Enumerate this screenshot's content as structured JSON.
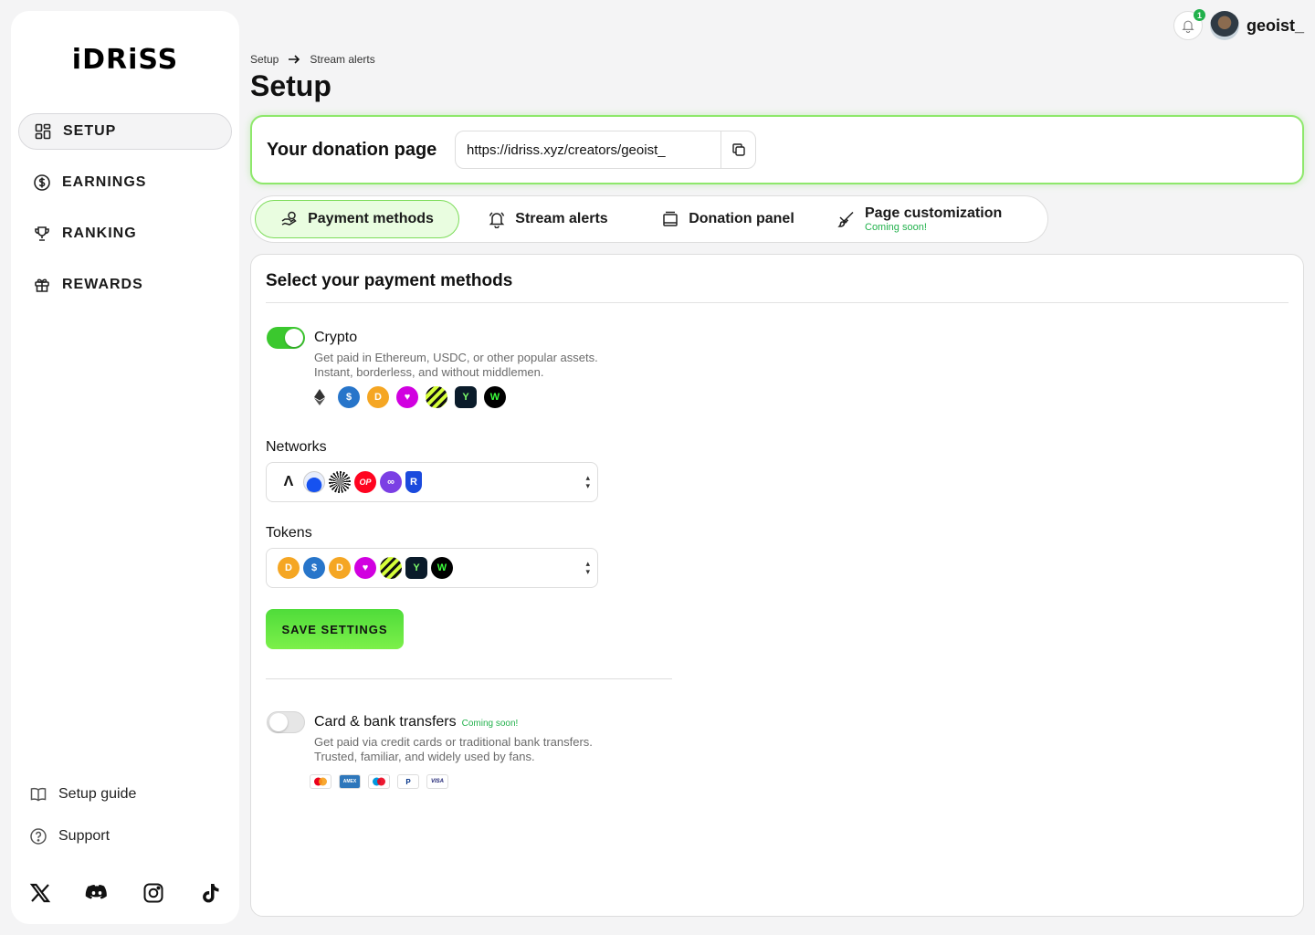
{
  "brand": {
    "logo": "iDRiSS"
  },
  "sidebar": {
    "items": [
      {
        "label": "SETUP",
        "icon": "dashboard-icon"
      },
      {
        "label": "EARNINGS",
        "icon": "dollar-icon"
      },
      {
        "label": "RANKING",
        "icon": "trophy-icon"
      },
      {
        "label": "REWARDS",
        "icon": "gift-icon"
      }
    ],
    "help": [
      {
        "label": "Setup guide",
        "icon": "book-icon"
      },
      {
        "label": "Support",
        "icon": "question-icon"
      }
    ],
    "socials": [
      "x-icon",
      "discord-icon",
      "instagram-icon",
      "tiktok-icon"
    ]
  },
  "topbar": {
    "notifications": "1",
    "username": "geoist_"
  },
  "header": {
    "breadcrumb": [
      "Setup",
      "Stream alerts"
    ],
    "title": "Setup"
  },
  "donation": {
    "label": "Your donation page",
    "url": "https://idriss.xyz/creators/geoist_"
  },
  "tabs": [
    {
      "label": "Payment methods",
      "icon": "payment-icon",
      "active": true
    },
    {
      "label": "Stream alerts",
      "icon": "bell-icon"
    },
    {
      "label": "Donation panel",
      "icon": "panel-icon"
    },
    {
      "label": "Page customization",
      "sub": "Coming soon!",
      "icon": "brush-icon"
    }
  ],
  "panel": {
    "title": "Select your payment methods",
    "crypto": {
      "title": "Crypto",
      "desc1": "Get paid in Ethereum, USDC, or other popular assets.",
      "desc2": "Instant, borderless, and without middlemen.",
      "enabled": true
    },
    "networks_label": "Networks",
    "tokens_label": "Tokens",
    "save_label": "SAVE SETTINGS",
    "card": {
      "title": "Card & bank transfers",
      "badge": "Coming soon!",
      "desc1": "Get paid via credit cards or traditional bank transfers.",
      "desc2": "Trusted, familiar, and widely used by fans.",
      "enabled": false
    }
  },
  "colors": {
    "accent": "#3bc82e",
    "accent_border": "#8ee86b",
    "coming_soon": "#22b14c"
  }
}
